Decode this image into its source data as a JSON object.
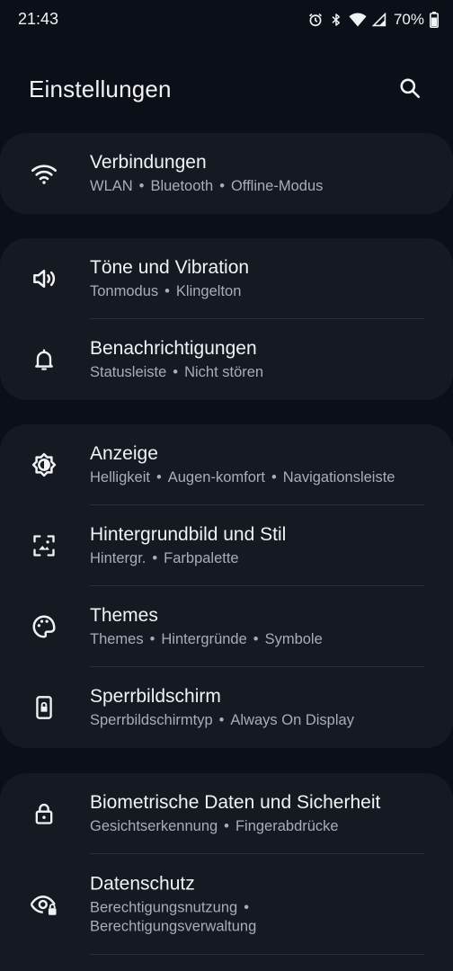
{
  "status": {
    "time": "21:43",
    "battery": "70%"
  },
  "header": {
    "title": "Einstellungen"
  },
  "groups": [
    {
      "items": [
        {
          "title": "Verbindungen",
          "subtitle": [
            "WLAN",
            "Bluetooth",
            "Offline-Modus"
          ],
          "icon": "wifi-icon"
        }
      ]
    },
    {
      "items": [
        {
          "title": "Töne und Vibration",
          "subtitle": [
            "Tonmodus",
            "Klingelton"
          ],
          "icon": "volume-icon"
        },
        {
          "title": "Benachrichtigungen",
          "subtitle": [
            "Statusleiste",
            "Nicht stören"
          ],
          "icon": "bell-icon"
        }
      ]
    },
    {
      "items": [
        {
          "title": "Anzeige",
          "subtitle": [
            "Helligkeit",
            "Augen-komfort",
            "Navigationsleiste"
          ],
          "icon": "brightness-icon"
        },
        {
          "title": "Hintergrundbild und Stil",
          "subtitle": [
            "Hintergr.",
            "Farbpalette"
          ],
          "icon": "wallpaper-icon"
        },
        {
          "title": "Themes",
          "subtitle": [
            "Themes",
            "Hintergründe",
            "Symbole"
          ],
          "icon": "palette-icon"
        },
        {
          "title": "Sperrbildschirm",
          "subtitle": [
            "Sperrbildschirmtyp",
            "Always On Display"
          ],
          "icon": "lockscreen-icon"
        }
      ]
    },
    {
      "items": [
        {
          "title": "Biometrische Daten und Sicherheit",
          "subtitle": [
            "Gesichtserkennung",
            "Fingerabdrücke"
          ],
          "icon": "lock-icon"
        },
        {
          "title": "Datenschutz",
          "subtitle": [
            "Berechtigungsnutzung",
            "Berechtigungsverwaltung"
          ],
          "icon": "privacy-eye-icon"
        }
      ]
    }
  ],
  "colors": {
    "background": "#0b0f18",
    "card": "#151922",
    "text": "#f1f2f4",
    "subtext": "#a8adb6"
  }
}
